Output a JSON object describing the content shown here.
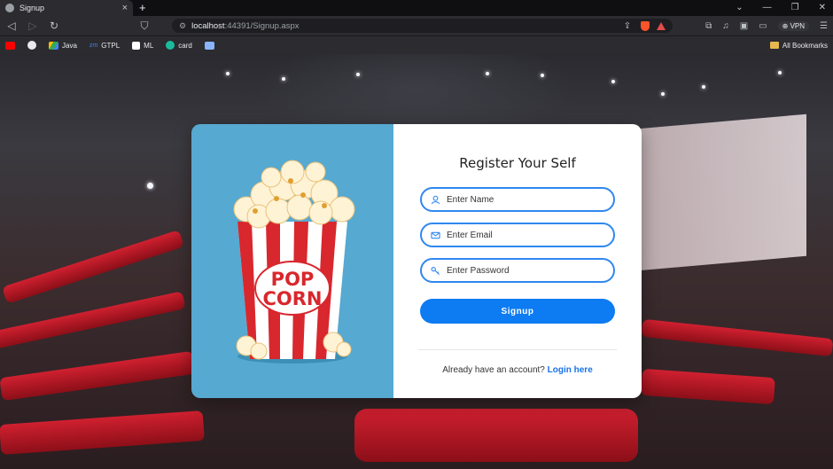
{
  "browser": {
    "tab_title": "Signup",
    "new_tab_symbol": "+",
    "url_host": "localhost",
    "url_path": ":44391/Signup.aspx",
    "vpn_label": "VPN",
    "window_controls": [
      "⌄",
      "—",
      "❐",
      "✕"
    ],
    "bookmarks": [
      {
        "label": "",
        "icon": "youtube-icon",
        "color": "#ff0000"
      },
      {
        "label": "",
        "icon": "github-icon",
        "color": "#e8eaed"
      },
      {
        "label": "Java",
        "icon": "drive-icon",
        "color": "#34a853"
      },
      {
        "label": "GTPL",
        "icon": "zm-icon",
        "color": "#4285f4"
      },
      {
        "label": "ML",
        "icon": "notion-icon",
        "color": "#ffffff"
      },
      {
        "label": "card",
        "icon": "card-icon",
        "color": "#1abc9c"
      },
      {
        "label": "",
        "icon": "app-icon",
        "color": "#8ab4f8"
      }
    ],
    "all_bookmarks": "All Bookmarks"
  },
  "page": {
    "form_title": "Register Your Self",
    "name_placeholder": "Enter Name",
    "email_placeholder": "Enter Email",
    "password_placeholder": "Enter Password",
    "signup_label": "Signup",
    "login_prompt": "Already have an account?",
    "login_link": "Login here",
    "popcorn_text_top": "POP",
    "popcorn_text_bottom": "CORN",
    "accent_color": "#0d7bf2",
    "panel_color": "#56a9d1"
  }
}
